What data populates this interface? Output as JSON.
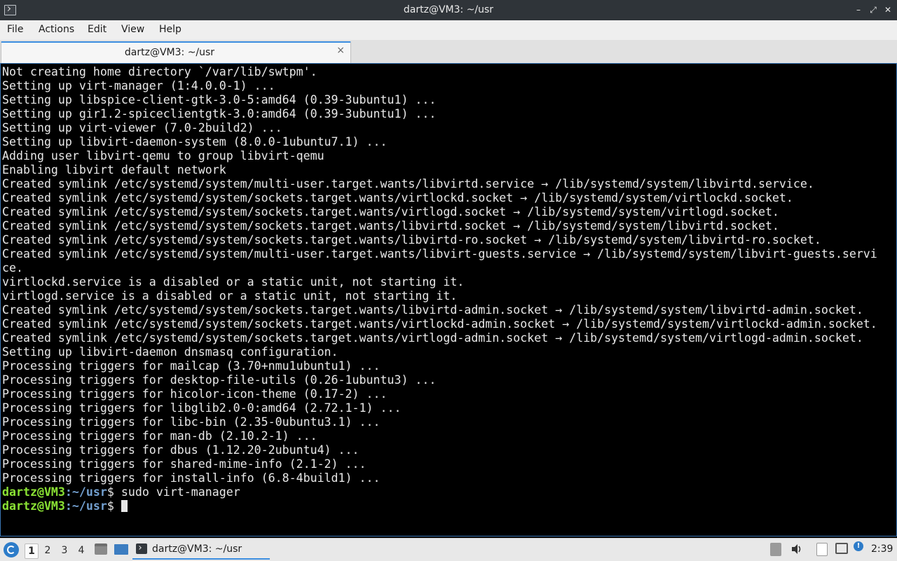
{
  "window": {
    "title": "dartz@VM3: ~/usr",
    "controls": {
      "minimize": "–",
      "maximize": "⤢",
      "close": "✕"
    }
  },
  "menu": [
    "File",
    "Actions",
    "Edit",
    "View",
    "Help"
  ],
  "tab": {
    "label": "dartz@VM3: ~/usr",
    "close": "×"
  },
  "terminal": {
    "lines": [
      "Not creating home directory `/var/lib/swtpm'.",
      "Setting up virt-manager (1:4.0.0-1) ...",
      "Setting up libspice-client-gtk-3.0-5:amd64 (0.39-3ubuntu1) ...",
      "Setting up gir1.2-spiceclientgtk-3.0:amd64 (0.39-3ubuntu1) ...",
      "Setting up virt-viewer (7.0-2build2) ...",
      "Setting up libvirt-daemon-system (8.0.0-1ubuntu7.1) ...",
      "Adding user libvirt-qemu to group libvirt-qemu",
      "Enabling libvirt default network",
      "Created symlink /etc/systemd/system/multi-user.target.wants/libvirtd.service → /lib/systemd/system/libvirtd.service.",
      "Created symlink /etc/systemd/system/sockets.target.wants/virtlockd.socket → /lib/systemd/system/virtlockd.socket.",
      "Created symlink /etc/systemd/system/sockets.target.wants/virtlogd.socket → /lib/systemd/system/virtlogd.socket.",
      "Created symlink /etc/systemd/system/sockets.target.wants/libvirtd.socket → /lib/systemd/system/libvirtd.socket.",
      "Created symlink /etc/systemd/system/sockets.target.wants/libvirtd-ro.socket → /lib/systemd/system/libvirtd-ro.socket.",
      "Created symlink /etc/systemd/system/multi-user.target.wants/libvirt-guests.service → /lib/systemd/system/libvirt-guests.servi",
      "ce.",
      "virtlockd.service is a disabled or a static unit, not starting it.",
      "virtlogd.service is a disabled or a static unit, not starting it.",
      "Created symlink /etc/systemd/system/sockets.target.wants/libvirtd-admin.socket → /lib/systemd/system/libvirtd-admin.socket.",
      "Created symlink /etc/systemd/system/sockets.target.wants/virtlockd-admin.socket → /lib/systemd/system/virtlockd-admin.socket.",
      "Created symlink /etc/systemd/system/sockets.target.wants/virtlogd-admin.socket → /lib/systemd/system/virtlogd-admin.socket.",
      "Setting up libvirt-daemon dnsmasq configuration.",
      "Processing triggers for mailcap (3.70+nmu1ubuntu1) ...",
      "Processing triggers for desktop-file-utils (0.26-1ubuntu3) ...",
      "Processing triggers for hicolor-icon-theme (0.17-2) ...",
      "Processing triggers for libglib2.0-0:amd64 (2.72.1-1) ...",
      "Processing triggers for libc-bin (2.35-0ubuntu3.1) ...",
      "Processing triggers for man-db (2.10.2-1) ...",
      "Processing triggers for dbus (1.12.20-2ubuntu4) ...",
      "Processing triggers for shared-mime-info (2.1-2) ...",
      "Processing triggers for install-info (6.8-4build1) ..."
    ],
    "prompts": [
      {
        "user": "dartz@VM3",
        "path": ":~/usr",
        "symbol": "$",
        "command": " sudo virt-manager"
      },
      {
        "user": "dartz@VM3",
        "path": ":~/usr",
        "symbol": "$",
        "command": " "
      }
    ]
  },
  "taskbar": {
    "workspaces": [
      "1",
      "2",
      "3",
      "4"
    ],
    "active_workspace": "1",
    "task_label": "dartz@VM3: ~/usr",
    "clock": "2:39",
    "update_badge": "!"
  },
  "colors": {
    "prompt_user": "#8ae234",
    "prompt_path": "#729fcf",
    "accent": "#3d8ee0"
  }
}
